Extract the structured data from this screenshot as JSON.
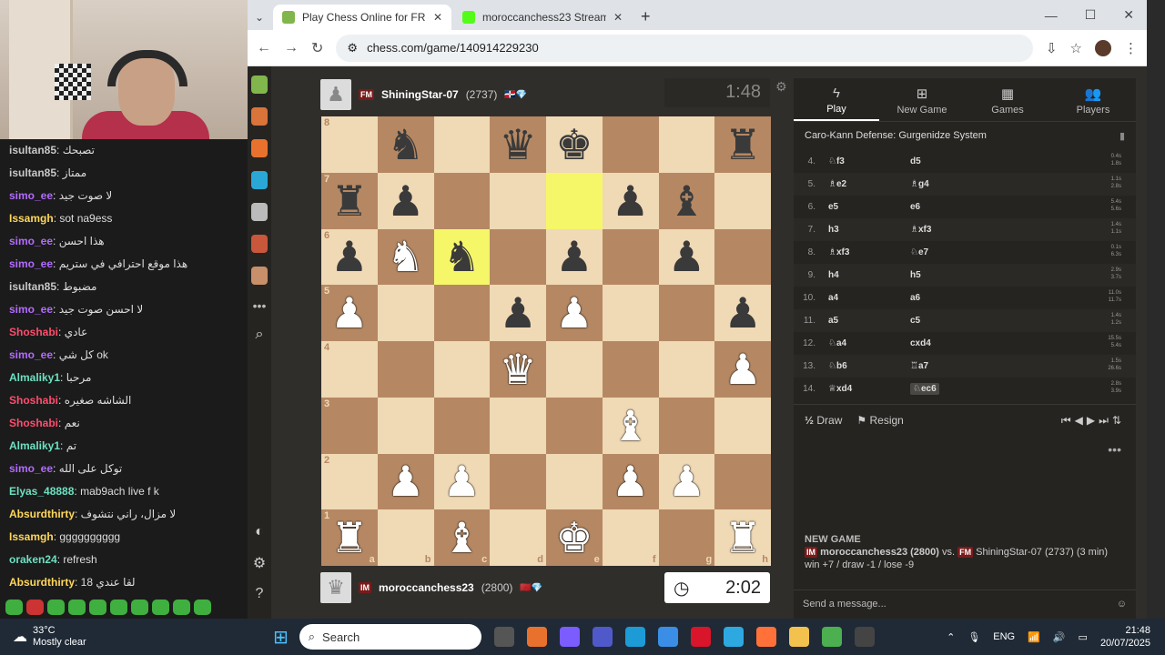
{
  "chat": [
    {
      "user": "isultan85",
      "text": "تصبحك",
      "color": "#c7c7c7"
    },
    {
      "user": "isultan85",
      "text": "ممتاز",
      "color": "#c7c7c7"
    },
    {
      "user": "simo_ee",
      "text": "لا صوت جيد",
      "color": "#b36bff"
    },
    {
      "user": "Issamgh",
      "text": "sot na9ess",
      "color": "#ffd75a"
    },
    {
      "user": "simo_ee",
      "text": "هذا احسن",
      "color": "#b36bff"
    },
    {
      "user": "simo_ee",
      "text": "هذا موقع احترافي في ستريم",
      "color": "#b36bff"
    },
    {
      "user": "isultan85",
      "text": "مضبوط",
      "color": "#c7c7c7"
    },
    {
      "user": "simo_ee",
      "text": "لا احسن صوت جيد",
      "color": "#b36bff"
    },
    {
      "user": "Shoshabi",
      "text": "عادي",
      "color": "#ff4d6d"
    },
    {
      "user": "simo_ee",
      "text": "كل شي ok",
      "color": "#b36bff"
    },
    {
      "user": "Almaliky1",
      "text": "مرحبا",
      "color": "#6de0c0"
    },
    {
      "user": "Shoshabi",
      "text": "الشاشه صغيره",
      "color": "#ff4d6d"
    },
    {
      "user": "Shoshabi",
      "text": "نعم",
      "color": "#ff4d6d"
    },
    {
      "user": "Almaliky1",
      "text": "تم",
      "color": "#6de0c0"
    },
    {
      "user": "simo_ee",
      "text": "توكل على الله",
      "color": "#b36bff"
    },
    {
      "user": "Elyas_48888",
      "text": "mab9ach live f k",
      "color": "#6de0c0"
    },
    {
      "user": "Absurdthirty",
      "text": "لا مزال، راني نتشوف",
      "color": "#ffd75a"
    },
    {
      "user": "Issamgh",
      "text": "gggggggggg",
      "color": "#ffd75a"
    },
    {
      "user": "oraken24",
      "text": "refresh",
      "color": "#6de0c0"
    },
    {
      "user": "Absurdthirty",
      "text": "18 لقا عندي",
      "color": "#ffd75a"
    }
  ],
  "browser": {
    "tab1": "Play Chess Online for FREE - 2 P",
    "tab2": "moroccanchess23 Stream - Wat",
    "new_tab": "+",
    "url": "chess.com/game/140914229230",
    "min": "—",
    "max": "☐",
    "close": "✕",
    "back": "←",
    "forward": "→",
    "reload": "↻"
  },
  "top_player": {
    "title": "FM",
    "name": "ShiningStar-07",
    "rating": "(2737)",
    "clock": "1:48"
  },
  "bottom_player": {
    "title": "IM",
    "name": "moroccanchess23",
    "rating": "(2800)",
    "clock": "2:02"
  },
  "board": [
    [
      "",
      "bn",
      "",
      "bq",
      "bk",
      "",
      "",
      "br"
    ],
    [
      "br",
      "bp",
      "",
      "",
      "",
      "bp",
      "bb",
      ""
    ],
    [
      "bp",
      "wn",
      "bn",
      "",
      "bp",
      "",
      "bp",
      ""
    ],
    [
      "wp",
      "",
      "",
      "bp",
      "wp",
      "",
      "",
      "bp"
    ],
    [
      "",
      "",
      "",
      "wq",
      "",
      "",
      "",
      "wp"
    ],
    [
      "",
      "",
      "",
      "",
      "",
      "wb",
      "",
      ""
    ],
    [
      "",
      "wp",
      "wp",
      "",
      "",
      "wp",
      "wp",
      ""
    ],
    [
      "wr",
      "",
      "wb",
      "",
      "wk",
      "",
      "",
      "wr"
    ]
  ],
  "highlights": [
    "e7",
    "c6"
  ],
  "ranks": [
    "8",
    "7",
    "6",
    "5",
    "4",
    "3",
    "2",
    "1"
  ],
  "files": [
    "a",
    "b",
    "c",
    "d",
    "e",
    "f",
    "g",
    "h"
  ],
  "panel": {
    "tabs": [
      "Play",
      "New Game",
      "Games",
      "Players"
    ],
    "opening": "Caro-Kann Defense: Gurgenidze System",
    "moves": [
      {
        "n": "4.",
        "w": "♘f3",
        "b": "d5",
        "t": [
          "0.4s",
          "1.8s"
        ]
      },
      {
        "n": "5.",
        "w": "♗e2",
        "b": "♗g4",
        "t": [
          "1.1s",
          "2.8s"
        ]
      },
      {
        "n": "6.",
        "w": "e5",
        "b": "e6",
        "t": [
          "5.4s",
          "5.6s"
        ]
      },
      {
        "n": "7.",
        "w": "h3",
        "b": "♗xf3",
        "t": [
          "1.4s",
          "1.1s"
        ]
      },
      {
        "n": "8.",
        "w": "♗xf3",
        "b": "♘e7",
        "t": [
          "0.1s",
          "6.3s"
        ]
      },
      {
        "n": "9.",
        "w": "h4",
        "b": "h5",
        "t": [
          "2.9s",
          "3.7s"
        ]
      },
      {
        "n": "10.",
        "w": "a4",
        "b": "a6",
        "t": [
          "11.0s",
          "11.7s"
        ]
      },
      {
        "n": "11.",
        "w": "a5",
        "b": "c5",
        "t": [
          "1.4s",
          "1.2s"
        ]
      },
      {
        "n": "12.",
        "w": "♘a4",
        "b": "cxd4",
        "t": [
          "15.5s",
          "5.4s"
        ]
      },
      {
        "n": "13.",
        "w": "♘b6",
        "b": "♖a7",
        "t": [
          "1.5s",
          "26.6s"
        ]
      },
      {
        "n": "14.",
        "w": "♕xd4",
        "b": "♘ec6",
        "t": [
          "2.8s",
          "3.9s"
        ]
      }
    ],
    "draw": "Draw",
    "resign": "Resign",
    "new_game_heading": "NEW GAME",
    "ng_p1": "moroccanchess23 (2800)",
    "ng_vs": " vs. ",
    "ng_p2": "ShiningStar-07 (2737) (3 min)",
    "ng_score": "win +7 / draw -1 / lose -9",
    "send": "Send a message..."
  },
  "taskbar": {
    "temp": "33°C",
    "weather": "Mostly clear",
    "search": "Search",
    "lang": "ENG",
    "time": "21:48",
    "date": "20/07/2025"
  }
}
